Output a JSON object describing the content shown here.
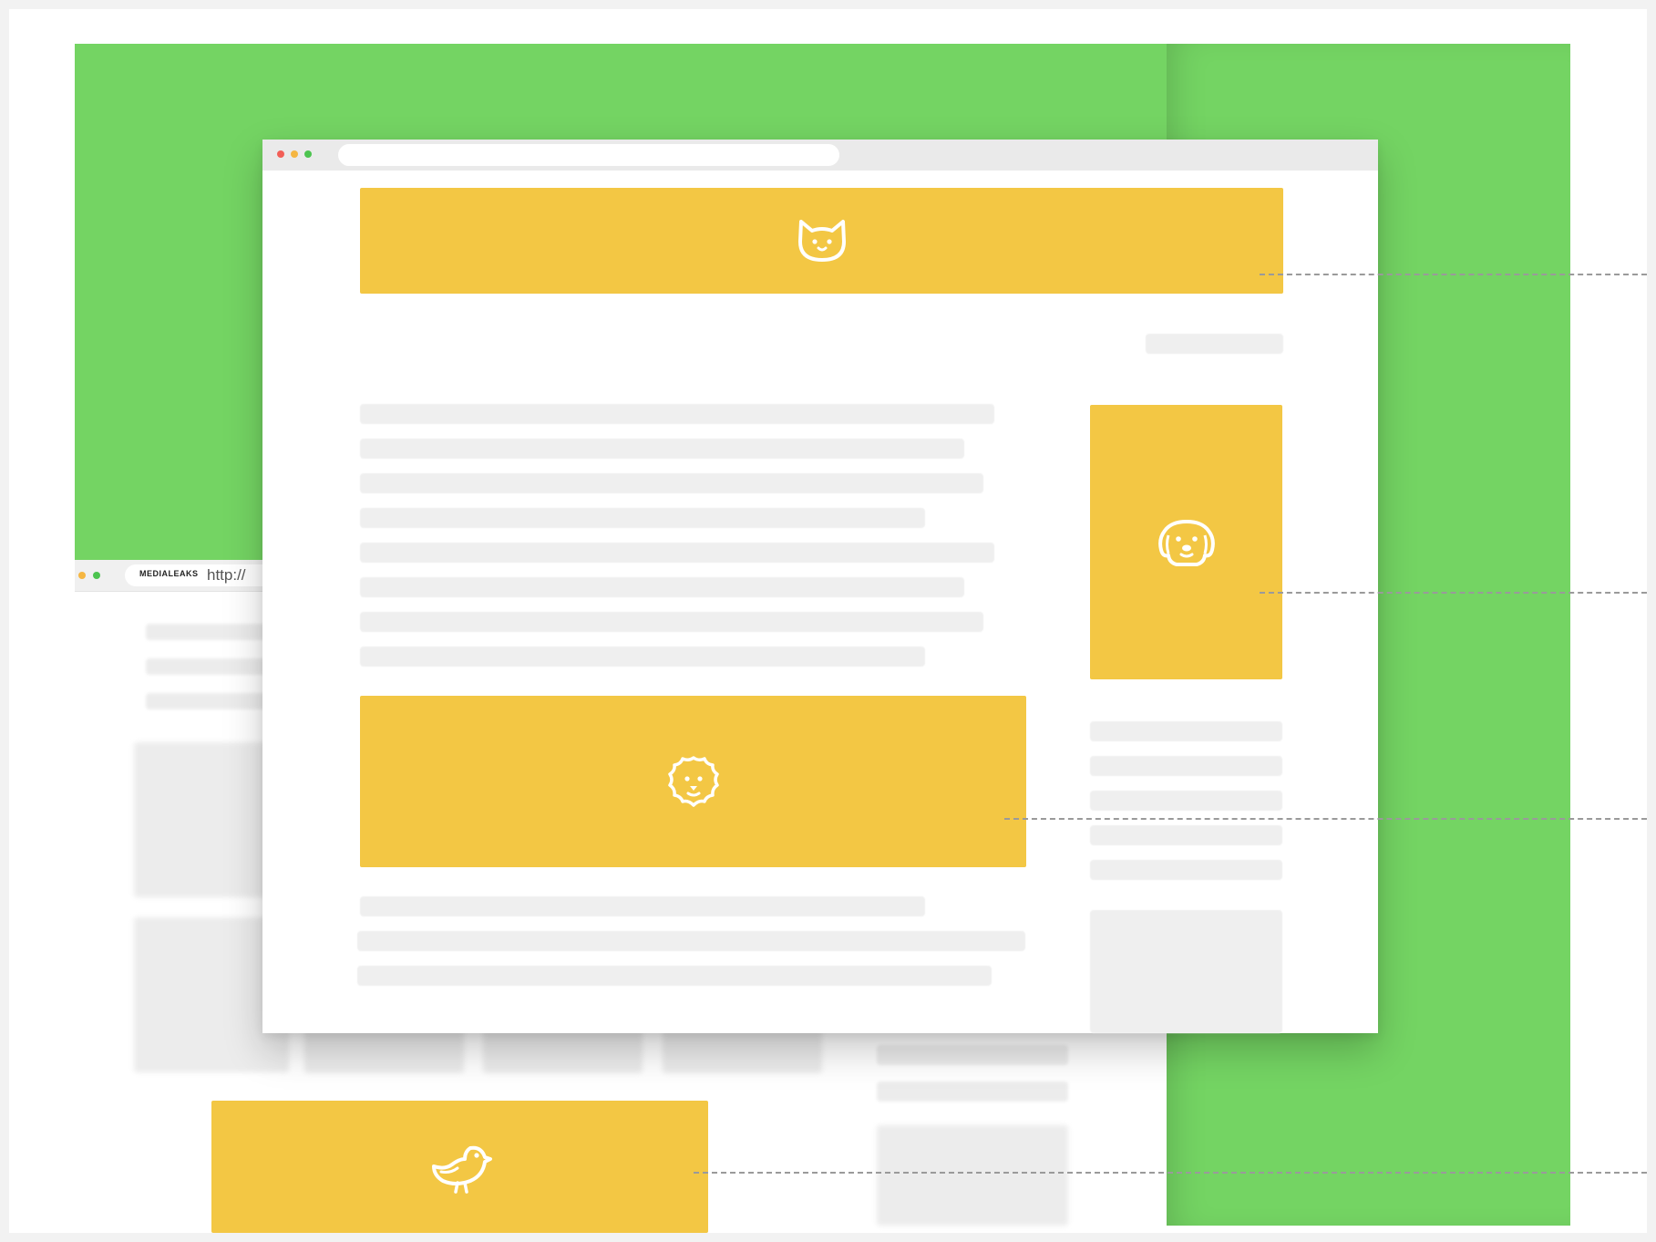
{
  "back_browser": {
    "logo_text": "MEDIALEAKS",
    "url_text": "http://"
  },
  "colors": {
    "canvas": "#ffffff",
    "frame_green": "#74d463",
    "ad_yellow": "#f3c744",
    "placeholder_gray": "#efefef",
    "dashed_line": "#9a9a9a"
  },
  "window_controls": [
    "close-dot",
    "minimize-dot",
    "maximize-dot"
  ],
  "ad_slots": [
    {
      "slot": "top-banner",
      "icon": "cat-icon"
    },
    {
      "slot": "sidebar-rectangle",
      "icon": "dog-icon"
    },
    {
      "slot": "in-content",
      "icon": "lion-icon"
    },
    {
      "slot": "bottom-banner",
      "icon": "bird-icon"
    }
  ]
}
